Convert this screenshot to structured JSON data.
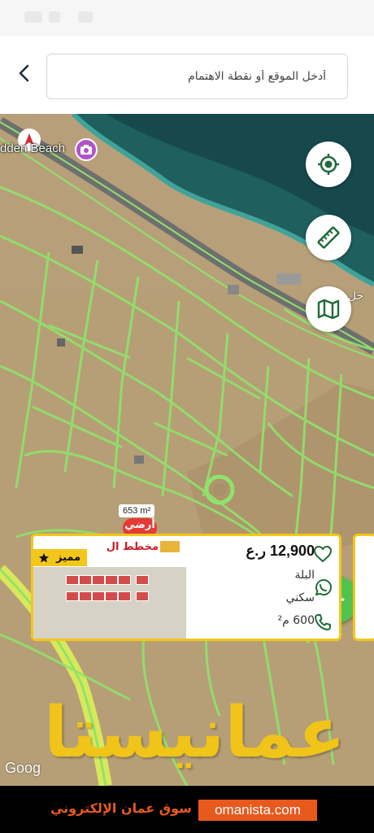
{
  "search": {
    "placeholder": "أدخل الموقع أو نقطة الاهتمام"
  },
  "map": {
    "poi_label": "dden Beach",
    "side_label": "جل",
    "area_tag": "653 m²",
    "pin_label": "أرضي",
    "google_logo": "Goog",
    "buttons": [
      "my-location",
      "measure-ruler",
      "map-layers"
    ]
  },
  "listing": {
    "thumb_title": "مخطط ال",
    "featured_label": "مميز",
    "price": "12,900",
    "currency": "ر.ع",
    "location": "البلة",
    "category": "سكني",
    "size": "600 م²"
  },
  "watermark": "عمانيستا",
  "footer": {
    "domain": "omanista.com",
    "tagline": "سوق عمان الإلكتروني"
  },
  "colors": {
    "accent_green": "#52c24f",
    "featured_yellow": "#f3c61a",
    "footer_orange": "#e8591c",
    "parcel_lines": "#8fe36b"
  }
}
